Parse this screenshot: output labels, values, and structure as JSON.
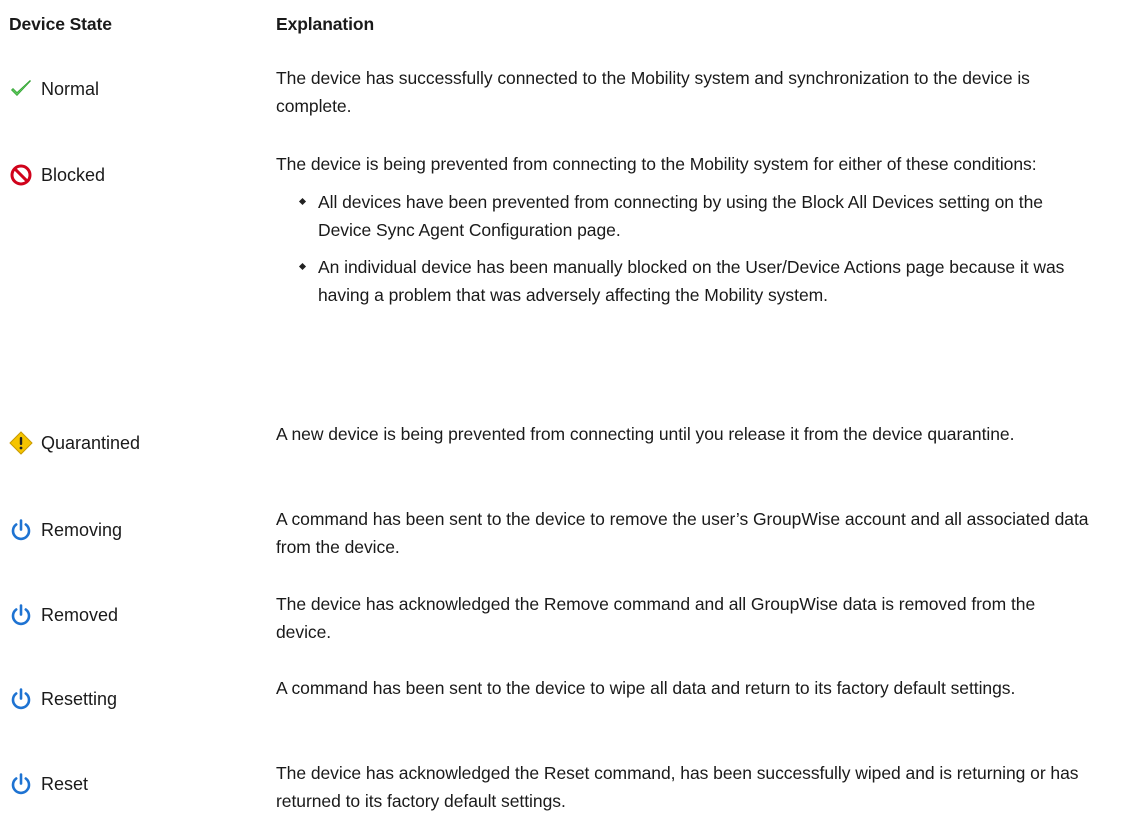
{
  "header": {
    "state_label": "Device State",
    "explanation_label": "Explanation"
  },
  "rows": [
    {
      "icon": "checkmark-icon",
      "state": "Normal",
      "explanation": "The device has successfully connected to the Mobility system and synchronization to the device is complete."
    },
    {
      "icon": "blocked-icon",
      "state": "Blocked",
      "explanation": "The device is being prevented from connecting to the Mobility system for either of these conditions:",
      "bullets": [
        "All devices have been prevented from connecting by using the Block All Devices setting on the Device Sync Agent Configuration page.",
        "An individual device has been manually blocked on the User/Device Actions page because it was having a problem that was adversely affecting the Mobility system."
      ]
    },
    {
      "icon": "warning-icon",
      "state": "Quarantined",
      "explanation": "A new device is being prevented from connecting until you release it from the device quarantine."
    },
    {
      "icon": "power-icon",
      "state": "Removing",
      "explanation": "A command has been sent to the device to remove the user’s GroupWise account and all associated data from the device."
    },
    {
      "icon": "power-icon",
      "state": "Removed",
      "explanation": "The device has acknowledged the Remove command and all GroupWise data is removed from the device."
    },
    {
      "icon": "power-icon",
      "state": "Resetting",
      "explanation": "A command has been sent to the device to wipe all data and return to its factory default settings."
    },
    {
      "icon": "power-icon",
      "state": "Reset",
      "explanation": "The device has acknowledged the Reset command, has been successfully wiped and is returning or has returned to its factory default settings."
    }
  ],
  "colors": {
    "check": "#2e9e2e",
    "blocked": "#d0021b",
    "warning": "#f5c400",
    "power": "#1e73d2"
  }
}
